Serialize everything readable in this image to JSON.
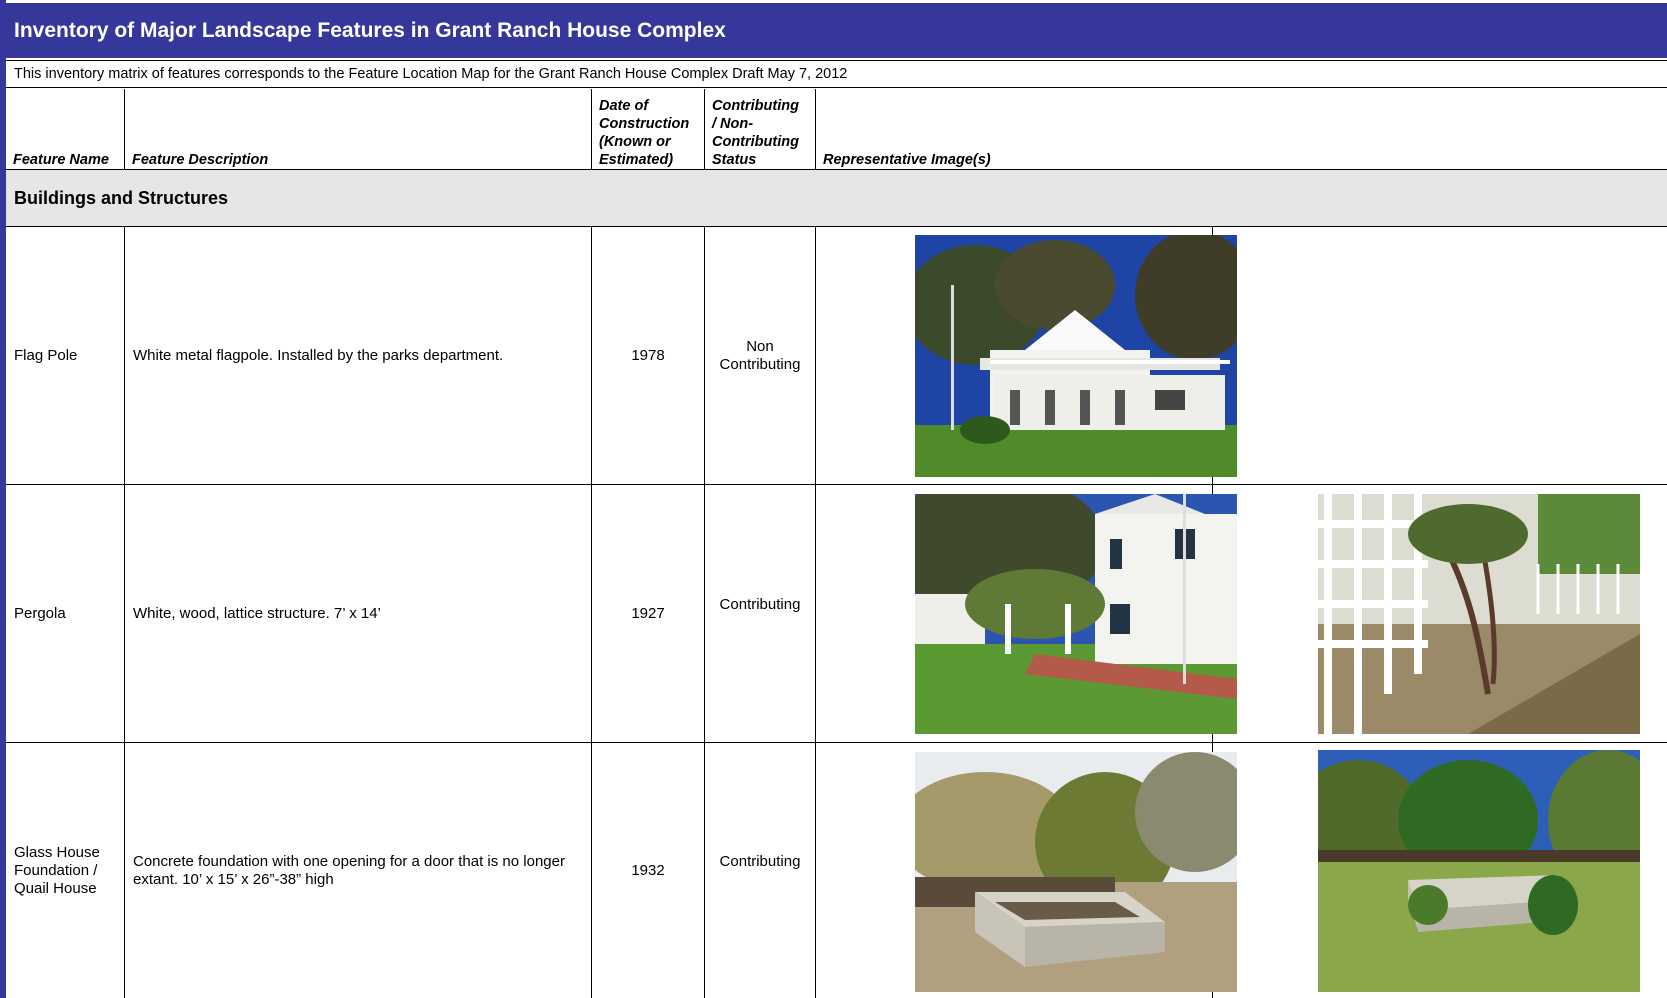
{
  "title": "Inventory of Major Landscape Features in Grant Ranch House Complex",
  "subtitle": "This inventory matrix of features corresponds to the Feature Location Map for the Grant Ranch House Complex  Draft May 7, 2012",
  "columns": {
    "feature_name": "Feature Name",
    "feature_description": "Feature Description",
    "date_line1": "Date of",
    "date_line2": "Construction",
    "date_line3": "(Known or",
    "date_line4": "Estimated)",
    "status_line1": "Contributing",
    "status_line2": "/ Non-",
    "status_line3": "Contributing",
    "status_line4": "Status",
    "images": "Representative Image(s)"
  },
  "section": "Buildings and Structures",
  "rows": [
    {
      "name": "Flag Pole",
      "description": "White metal flagpole. Installed by the parks department.",
      "date": "1978",
      "status_line1": "Non",
      "status_line2": "Contributing",
      "images": [
        "white-house-with-flagpole-photo"
      ]
    },
    {
      "name": "Pergola",
      "description": "White, wood, lattice structure. 7’ x 14’",
      "date": "1927",
      "status_line1": "Contributing",
      "images": [
        "house-with-pergola-photo",
        "lattice-pergola-closeup-photo"
      ]
    },
    {
      "name_line1": "Glass House",
      "name_line2": "Foundation /",
      "name_line3": "Quail House",
      "description_line1": "Concrete foundation with one opening for a door that is no longer",
      "description_line2": "extant. 10’ x 15’ x 26”-38” high",
      "date": "1932",
      "status_line1": "Contributing",
      "images": [
        "concrete-foundation-photo",
        "concrete-foundation-garden-photo"
      ]
    }
  ],
  "colors": {
    "title_bar": "#35379a",
    "section_band": "#e6e6e6",
    "grass": "#4f8a2b",
    "sky": "#1f47a8"
  }
}
